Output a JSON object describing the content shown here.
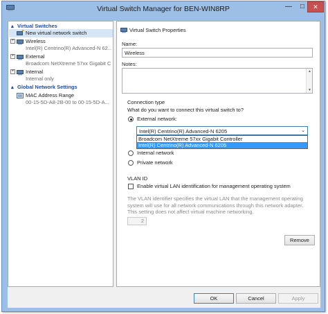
{
  "window": {
    "title": "Virtual Switch Manager for BEN-WIN8RP"
  },
  "titlebar": {
    "minimize": "—",
    "maximize": "□",
    "close": "✕"
  },
  "left": {
    "virtual_switches": {
      "header": "Virtual Switches",
      "items": [
        {
          "name": "New virtual network switch",
          "subtitle": ""
        },
        {
          "name": "Wireless",
          "subtitle": "Intel(R) Centrino(R) Advanced-N 62..."
        },
        {
          "name": "External",
          "subtitle": "Broadcom NetXtreme 57xx Gigabit C..."
        },
        {
          "name": "Internal",
          "subtitle": "Internal only"
        }
      ]
    },
    "global_settings": {
      "header": "Global Network Settings",
      "items": [
        {
          "name": "MAC Address Range",
          "subtitle": "00-15-5D-A8-2B-00 to 00-15-5D-A..."
        }
      ]
    },
    "expander_glyph": "+",
    "collapse_arrow": "▴"
  },
  "right": {
    "pane_title": "Virtual Switch Properties",
    "name_label": "Name:",
    "name_value": "Wireless",
    "notes_label": "Notes:",
    "connection_type": {
      "group_label": "Connection type",
      "question": "What do you want to connect this virtual switch to?",
      "options": [
        "External network:",
        "Internal network",
        "Private network"
      ],
      "selected_index": 0,
      "adapter_selected": "Intel(R) Centrino(R) Advanced-N 6205",
      "adapter_options": [
        "Broadcom NetXtreme 57xx Gigabit Controller",
        "Intel(R) Centrino(R) Advanced-N 6205"
      ],
      "highlighted_option": 1
    },
    "vlan": {
      "group_label": "VLAN ID",
      "checkbox_label": "Enable virtual LAN identification for management operating system",
      "checked": false,
      "description": "The VLAN identifier specifies the virtual LAN that the management operating system will use for all network communications through this network adapter. This setting does not affect virtual machine networking.",
      "value": "2"
    },
    "remove_button": "Remove"
  },
  "footer": {
    "ok": "OK",
    "cancel": "Cancel",
    "apply": "Apply"
  },
  "colors": {
    "accent": "#3399ff",
    "section_header": "#1e4e9e",
    "window_frame": "#9dbfe6",
    "close_button": "#c75050"
  }
}
